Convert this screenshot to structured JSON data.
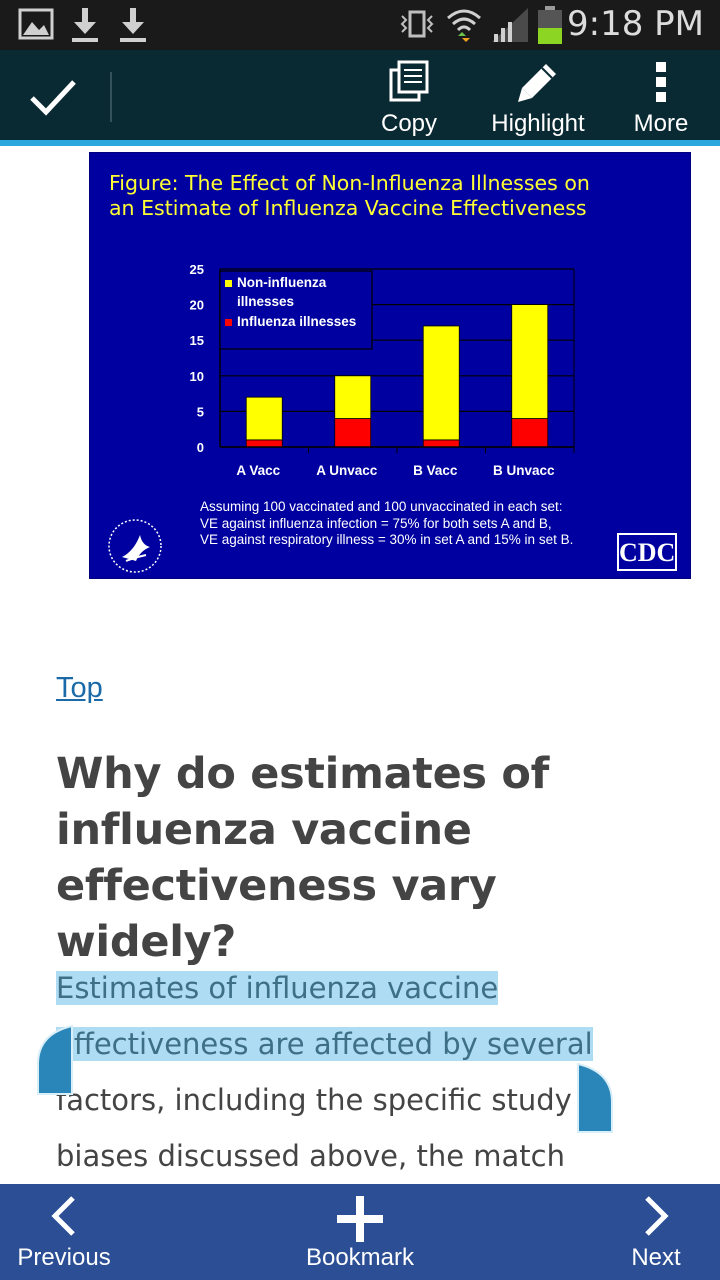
{
  "status_bar": {
    "time": "9:18 PM",
    "icons": [
      "gallery-icon",
      "download-icon",
      "download-icon",
      "vibrate-icon",
      "wifi-icon",
      "signal-icon",
      "battery-icon"
    ]
  },
  "action_bar": {
    "done_icon": "checkmark-icon",
    "copy_label": "Copy",
    "highlight_label": "Highlight",
    "more_label": "More"
  },
  "figure": {
    "title_line1": "Figure: The Effect of Non-Influenza Illnesses on",
    "title_line2": "an Estimate of Influenza Vaccine Effectiveness",
    "note_line1": "Assuming 100 vaccinated and 100 unvaccinated in each set:",
    "note_line2": "VE against influenza infection = 75% for both sets A and B,",
    "note_line3": "VE against respiratory illness = 30% in set A and 15% in set B.",
    "cdc_logo_text": "CDC"
  },
  "chart_data": {
    "type": "bar",
    "stacked": true,
    "categories": [
      "A Vacc",
      "A Unvacc",
      "B Vacc",
      "B Unvacc"
    ],
    "series": [
      {
        "name": "Influenza illnesses",
        "values": [
          1,
          4,
          1,
          4
        ],
        "color": "#ff0000"
      },
      {
        "name": "Non-influenza illnesses",
        "values": [
          6,
          6,
          16,
          16
        ],
        "color": "#ffff00"
      }
    ],
    "legend_lines": [
      "Non-influenza",
      "illnesses",
      "Influenza illnesses"
    ],
    "y_ticks": [
      "25",
      "20",
      "15",
      "10",
      "5",
      "0"
    ],
    "ylim": [
      0,
      25
    ],
    "grid": true,
    "legend_position": "top-left",
    "background": "#0000a0"
  },
  "article": {
    "top_link": "Top",
    "heading_line1": "Why do estimates of",
    "heading_line2": "influenza vaccine",
    "heading_line3": "effectiveness vary widely?",
    "para_line1": "Estimates of influenza vaccine",
    "para_line2": "effectiveness are affected by several",
    "para_line3": "factors, including the specific study",
    "para_line4": "biases discussed above, the match"
  },
  "bottom_bar": {
    "previous_label": "Previous",
    "bookmark_label": "Bookmark",
    "next_label": "Next"
  },
  "colors": {
    "action_bar_bg": "#0a2a33",
    "accent": "#2aa8de",
    "bottom_bar_bg": "#2b4e94",
    "selection": "#aedcf2",
    "link": "#1a6aa8"
  }
}
